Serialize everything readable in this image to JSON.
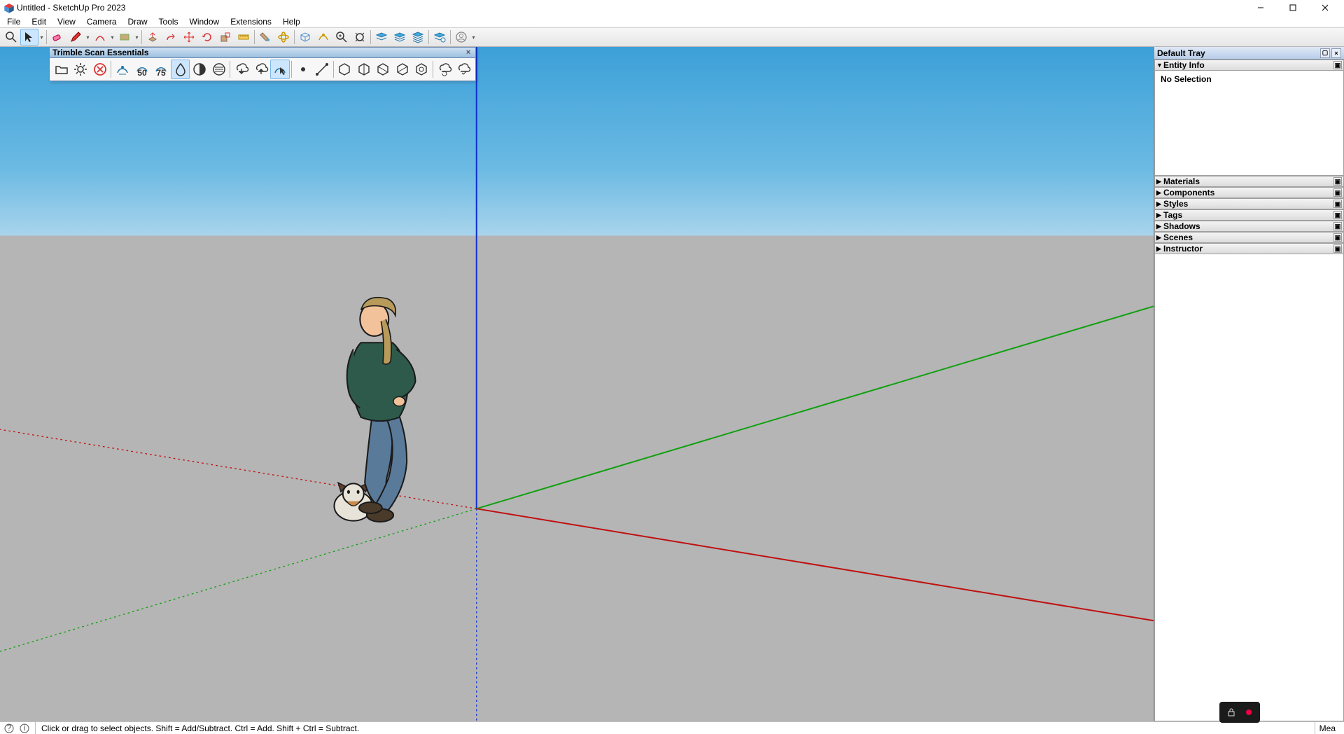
{
  "window": {
    "title": "Untitled - SketchUp Pro 2023"
  },
  "menu": {
    "items": [
      "File",
      "Edit",
      "View",
      "Camera",
      "Draw",
      "Tools",
      "Window",
      "Extensions",
      "Help"
    ]
  },
  "toolbar": {
    "icons": [
      "magnify",
      "select",
      "dd",
      "sep",
      "eraser",
      "pencil",
      "dd",
      "arc",
      "dd",
      "rect",
      "dd",
      "sep",
      "pushpull",
      "followme",
      "move",
      "rotate",
      "scale",
      "tape",
      "sep",
      "paint",
      "orbit",
      "sep",
      "extrude-a",
      "extrude-b",
      "zoom",
      "zoom-ext",
      "sep",
      "sandbox-a",
      "sandbox-b",
      "sandbox-c",
      "sep",
      "sandbox-d",
      "sep",
      "user",
      "dd"
    ]
  },
  "floating": {
    "title": "Trimble Scan Essentials",
    "icons": [
      "folder",
      "gear",
      "close-circle",
      "sep",
      "scan-a",
      "scan-50",
      "scan-75",
      "droplet",
      "contrast",
      "shade",
      "sep",
      "cloud-dn",
      "cloud-up",
      "scan-sel",
      "sep",
      "dot",
      "line",
      "sep",
      "hex-a",
      "hex-b",
      "hex-c",
      "hex-d",
      "hex-e",
      "sep",
      "cloud-r1",
      "cloud-r2"
    ]
  },
  "tray": {
    "title": "Default Tray",
    "entity_info": {
      "label": "Entity Info",
      "status": "No Selection"
    },
    "panels": [
      "Materials",
      "Components",
      "Styles",
      "Tags",
      "Shadows",
      "Scenes",
      "Instructor"
    ]
  },
  "status": {
    "hint": "Click or drag to select objects. Shift = Add/Subtract. Ctrl = Add. Shift + Ctrl = Subtract.",
    "measure_label": "Mea"
  },
  "chart_data": null
}
